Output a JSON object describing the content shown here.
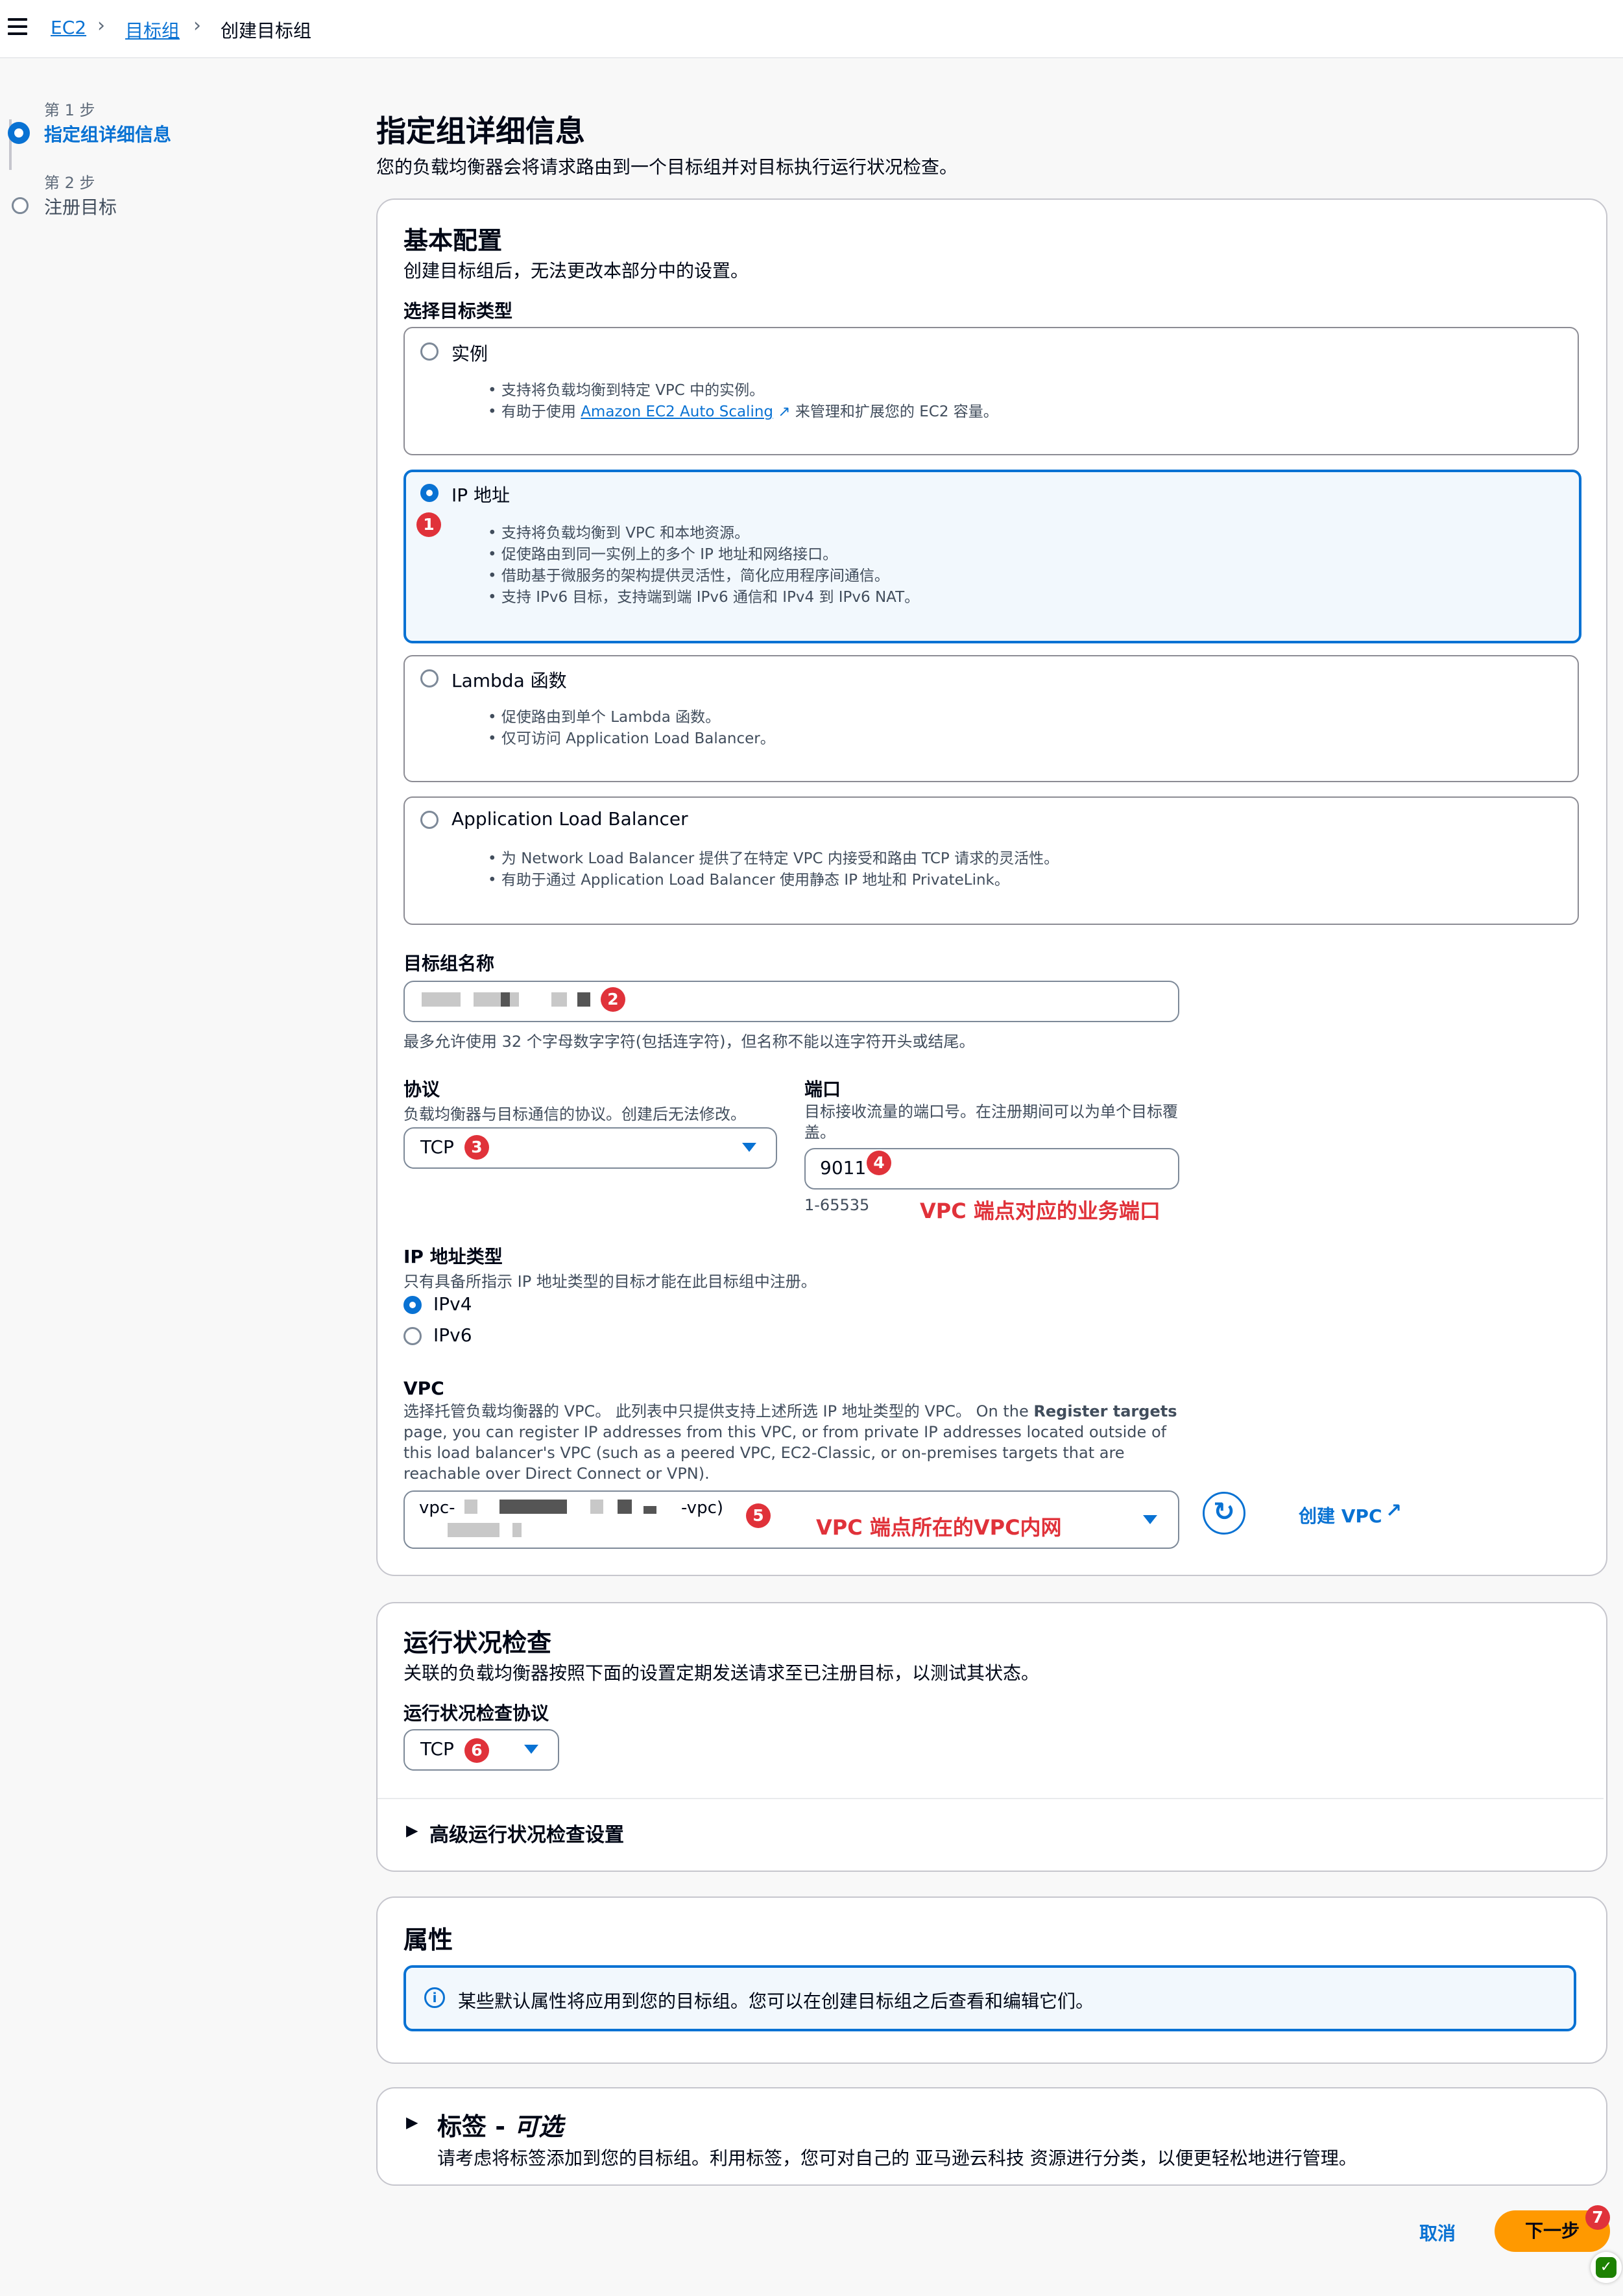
{
  "breadcrumb": {
    "root": "EC2",
    "parent": "目标组",
    "current": "创建目标组"
  },
  "steps": [
    {
      "num": "第 1 步",
      "label": "指定组详细信息"
    },
    {
      "num": "第 2 步",
      "label": "注册目标"
    }
  ],
  "page": {
    "title": "指定组详细信息",
    "description": "您的负载均衡器会将请求路由到一个目标组并对目标执行运行状况检查。"
  },
  "basic": {
    "title": "基本配置",
    "description": "创建目标组后，无法更改本部分中的设置。",
    "target_type_label": "选择目标类型",
    "options": [
      {
        "title": "实例",
        "bullets": [
          "支持将负载均衡到特定 VPC 中的实例。"
        ],
        "b2_pre": "有助于使用",
        "b2_link": "Amazon EC2 Auto Scaling",
        "b2_post": "来管理和扩展您的 EC2 容量。"
      },
      {
        "title": "IP 地址",
        "bullets": [
          "支持将负载均衡到 VPC 和本地资源。",
          "促使路由到同一实例上的多个 IP 地址和网络接口。",
          "借助基于微服务的架构提供灵活性，简化应用程序间通信。",
          "支持 IPv6 目标，支持端到端 IPv6 通信和 IPv4 到 IPv6 NAT。"
        ]
      },
      {
        "title": "Lambda 函数",
        "bullets": [
          "促使路由到单个 Lambda 函数。",
          "仅可访问 Application Load Balancer。"
        ]
      },
      {
        "title": "Application Load Balancer",
        "bullets": [
          "为 Network Load Balancer 提供了在特定 VPC 内接受和路由 TCP 请求的灵活性。",
          "有助于通过 Application Load Balancer 使用静态 IP 地址和 PrivateLink。"
        ]
      }
    ],
    "name_label": "目标组名称",
    "name_hint": "最多允许使用 32 个字母数字字符(包括连字符)，但名称不能以连字符开头或结尾。",
    "protocol_label": "协议",
    "protocol_desc": "负载均衡器与目标通信的协议。创建后无法修改。",
    "protocol_value": "TCP",
    "port_label": "端口",
    "port_desc": "目标接收流量的端口号。在注册期间可以为单个目标覆盖。",
    "port_value": "9011",
    "port_range": "1-65535",
    "port_note": "VPC 端点对应的业务端口",
    "ip_type_label": "IP 地址类型",
    "ip_type_desc": "只有具备所指示 IP 地址类型的目标才能在此目标组中注册。",
    "ip_options": [
      "IPv4",
      "IPv6"
    ],
    "vpc_label": "VPC",
    "vpc_desc_pre": "选择托管负载均衡器的 VPC。 此列表中只提供支持上述所选 IP 地址类型的 VPC。 On the ",
    "vpc_desc_bold": "Register targets",
    "vpc_desc_post": " page, you can register IP addresses from this VPC, or from private IP addresses located outside of this load balancer's VPC (such as a peered VPC, EC2-Classic, or on-premises targets that are reachable over Direct Connect or VPN).",
    "vpc_prefix": "vpc-",
    "vpc_suffix": "-vpc)",
    "vpc_note": "VPC 端点所在的VPC内网",
    "create_vpc": "创建 VPC"
  },
  "health": {
    "title": "运行状况检查",
    "description": "关联的负载均衡器按照下面的设置定期发送请求至已注册目标，以测试其状态。",
    "protocol_label": "运行状况检查协议",
    "protocol_value": "TCP",
    "advanced": "高级运行状况检查设置"
  },
  "attributes": {
    "title": "属性",
    "info": "某些默认属性将应用到您的目标组。您可以在创建目标组之后查看和编辑它们。"
  },
  "tags": {
    "title": "标签 - ",
    "optional": "可选",
    "description": "请考虑将标签添加到您的目标组。利用标签，您可对自己的 亚马逊云科技 资源进行分类，以便更轻松地进行管理。"
  },
  "footer": {
    "cancel": "取消",
    "next": "下一步"
  },
  "badges": [
    "1",
    "2",
    "3",
    "4",
    "5",
    "6",
    "7"
  ],
  "colors": {
    "primary": "#0972d3",
    "badge": "#e0323a",
    "next_button": "#ff9900"
  }
}
